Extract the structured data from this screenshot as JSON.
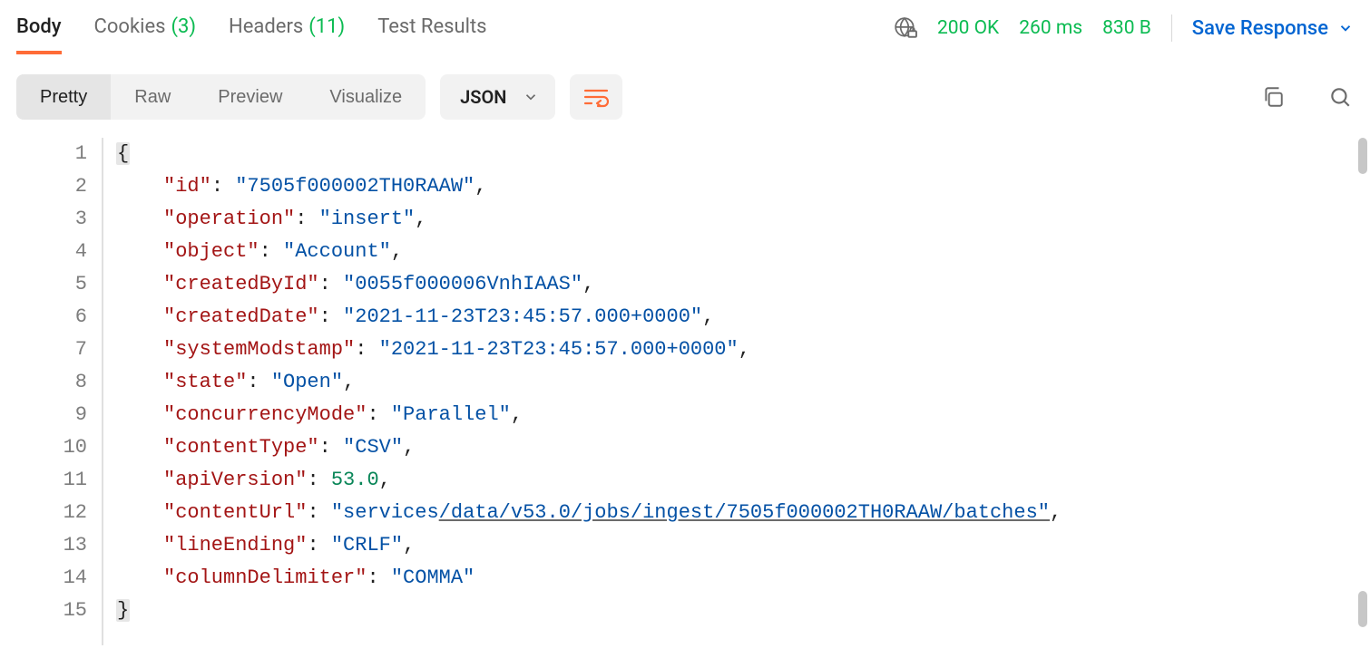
{
  "tabs": {
    "body": "Body",
    "cookies_label": "Cookies",
    "cookies_count": "(3)",
    "headers_label": "Headers",
    "headers_count": "(11)",
    "test_results": "Test Results"
  },
  "status": {
    "code": "200 OK",
    "time": "260 ms",
    "size": "830 B"
  },
  "save_response": "Save Response",
  "view_modes": {
    "pretty": "Pretty",
    "raw": "Raw",
    "preview": "Preview",
    "visualize": "Visualize"
  },
  "format_dropdown": "JSON",
  "json_body": {
    "id": "7505f000002TH0RAAW",
    "operation": "insert",
    "object": "Account",
    "createdById": "0055f000006VnhIAAS",
    "createdDate": "2021-11-23T23:45:57.000+0000",
    "systemModstamp": "2021-11-23T23:45:57.000+0000",
    "state": "Open",
    "concurrencyMode": "Parallel",
    "contentType": "CSV",
    "apiVersion": 53.0,
    "contentUrl": "services/data/v53.0/jobs/ingest/7505f000002TH0RAAW/batches",
    "lineEnding": "CRLF",
    "columnDelimiter": "COMMA"
  },
  "keys": {
    "id": "\"id\"",
    "operation": "\"operation\"",
    "object": "\"object\"",
    "createdById": "\"createdById\"",
    "createdDate": "\"createdDate\"",
    "systemModstamp": "\"systemModstamp\"",
    "state": "\"state\"",
    "concurrencyMode": "\"concurrencyMode\"",
    "contentType": "\"contentType\"",
    "apiVersion": "\"apiVersion\"",
    "contentUrl": "\"contentUrl\"",
    "lineEnding": "\"lineEnding\"",
    "columnDelimiter": "\"columnDelimiter\""
  },
  "vals": {
    "id": "\"7505f000002TH0RAAW\"",
    "operation": "\"insert\"",
    "object": "\"Account\"",
    "createdById": "\"0055f000006VnhIAAS\"",
    "createdDate": "\"2021-11-23T23:45:57.000+0000\"",
    "systemModstamp": "\"2021-11-23T23:45:57.000+0000\"",
    "state": "\"Open\"",
    "concurrencyMode": "\"Parallel\"",
    "contentType": "\"CSV\"",
    "apiVersion": "53.0",
    "contentUrl_prefix": "\"services",
    "contentUrl_rest": "/data/v53.0/jobs/ingest/7505f000002TH0RAAW/batches\"",
    "lineEnding": "\"CRLF\"",
    "columnDelimiter": "\"COMMA\""
  },
  "braces": {
    "open": "{",
    "close": "}"
  },
  "punct": {
    "colon": ":",
    "comma": ","
  },
  "line_numbers": [
    "1",
    "2",
    "3",
    "4",
    "5",
    "6",
    "7",
    "8",
    "9",
    "10",
    "11",
    "12",
    "13",
    "14",
    "15"
  ]
}
